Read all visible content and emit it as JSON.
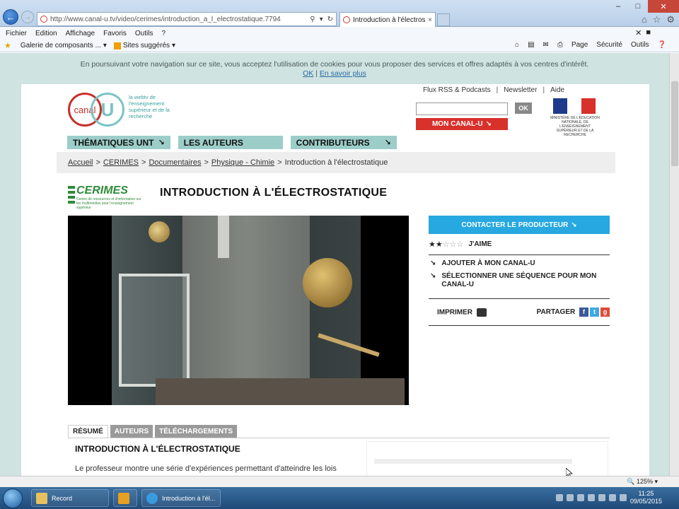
{
  "browser": {
    "url": "http://www.canal-u.tv/video/cerimes/introduction_a_l_electrostatique.7794",
    "tab_title": "Introduction à l'électrostati...",
    "tab_close": "×",
    "menu": [
      "Fichier",
      "Edition",
      "Affichage",
      "Favoris",
      "Outils",
      "?"
    ],
    "favorites": {
      "gallery": "Galerie de composants ...",
      "suggested": "Sites suggérés"
    },
    "toolbar": {
      "page": "Page",
      "securite": "Sécurité",
      "outils": "Outils"
    },
    "zoom": "125%"
  },
  "cookie": {
    "text": "En poursuivant votre navigation sur ce site, vous acceptez l'utilisation de cookies pour vous proposer des services et offres adaptés à vos centres d'intérêt.",
    "ok": "OK",
    "sep": "|",
    "more": "En savoir plus"
  },
  "header": {
    "logo_canal": "canal",
    "logo_u": "U",
    "logo_tagline": "la webtv de l'enseignement supérieur et de la recherche",
    "links": [
      "Flux RSS & Podcasts",
      "Newsletter",
      "Aide"
    ],
    "link_sep": "|",
    "ok_label": "OK",
    "mon_canal": "MON CANAL-U",
    "ministry": "MINISTÈRE DE L'ÉDUCATION NATIONALE, DE L'ENSEIGNEMENT SUPÉRIEUR ET DE LA RECHERCHE"
  },
  "nav": [
    {
      "label": "THÉMATIQUES UNT"
    },
    {
      "label": "LES AUTEURS"
    },
    {
      "label": "CONTRIBUTEURS"
    }
  ],
  "breadcrumb": {
    "items": [
      "Accueil",
      "CERIMES",
      "Documentaires",
      "Physique - Chimie"
    ],
    "current": "Introduction à l'électrostatique",
    "sep": ">"
  },
  "producer": {
    "name": "CERIMES",
    "subtitle": "Centre de ressources et d'information sur les multimédias pour l'enseignement supérieur"
  },
  "video": {
    "title": "INTRODUCTION À L'ÉLECTROSTATIQUE"
  },
  "side": {
    "contact": "CONTACTER LE PRODUCTEUR",
    "rating_value": 2,
    "rating_max": 5,
    "like": "J'AIME",
    "add": "AJOUTER À MON CANAL-U",
    "select_seq": "SÉLECTIONNER UNE SÉQUENCE POUR MON CANAL-U",
    "print": "IMPRIMER",
    "share": "PARTAGER"
  },
  "tabs": [
    {
      "label": "RÉSUMÉ",
      "active": true
    },
    {
      "label": "AUTEURS",
      "active": false
    },
    {
      "label": "TÉLÉCHARGEMENTS",
      "active": false
    }
  ],
  "summary": {
    "title": "INTRODUCTION À L'ÉLECTROSTATIQUE",
    "text": "Le professeur montre une série d'expériences permettant d'atteindre les lois"
  },
  "taskbar": {
    "record": "Record",
    "ie_task": "Introduction à l'él...",
    "time": "11:25",
    "date": "09/05/2015"
  },
  "colors": {
    "accent": "#28a8e0",
    "nav": "#9ccdc9",
    "red": "#d8302a",
    "cerimes": "#2e8c3a"
  }
}
